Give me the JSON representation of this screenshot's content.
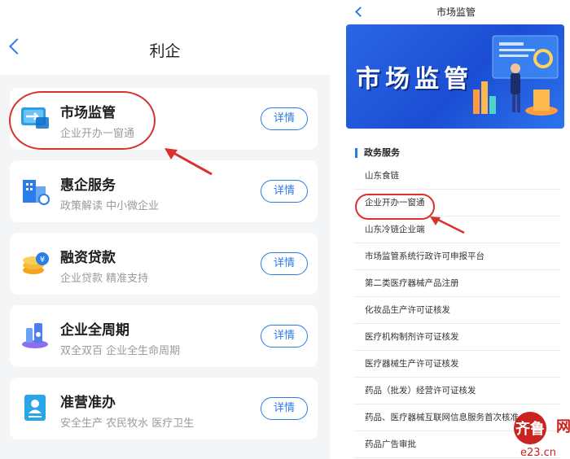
{
  "left": {
    "title": "利企",
    "cards": [
      {
        "name": "市场监管",
        "desc": "企业开办一窗通",
        "btn": "详情"
      },
      {
        "name": "惠企服务",
        "desc": "政策解读 中小微企业",
        "btn": "详情"
      },
      {
        "name": "融资贷款",
        "desc": "企业贷款 精准支持",
        "btn": "详情"
      },
      {
        "name": "企业全周期",
        "desc": "双全双百 企业全生命周期",
        "btn": "详情"
      },
      {
        "name": "准营准办",
        "desc": "安全生产 农民牧水 医疗卫生",
        "btn": "详情"
      }
    ]
  },
  "right": {
    "title": "市场监管",
    "banner_title": "市场监管",
    "section_title": "政务服务",
    "items": [
      "山东食链",
      "企业开办一窗通",
      "山东冷链企业端",
      "市场监管系统行政许可申报平台",
      "第二类医疗器械产品注册",
      "化妆品生产许可证核发",
      "医疗机构制剂许可证核发",
      "医疗器械生产许可证核发",
      "药品（批发）经营许可证核发",
      "药品、医疗器械互联网信息服务首次核准",
      "药品广告审批"
    ]
  },
  "watermark": {
    "left": "齐鲁",
    "right": "齐鲁",
    "site": "e23.cn",
    "net": "网"
  },
  "colors": {
    "accent": "#2c7be5",
    "annotation": "#d8322f",
    "banner": "#2b66e6"
  }
}
